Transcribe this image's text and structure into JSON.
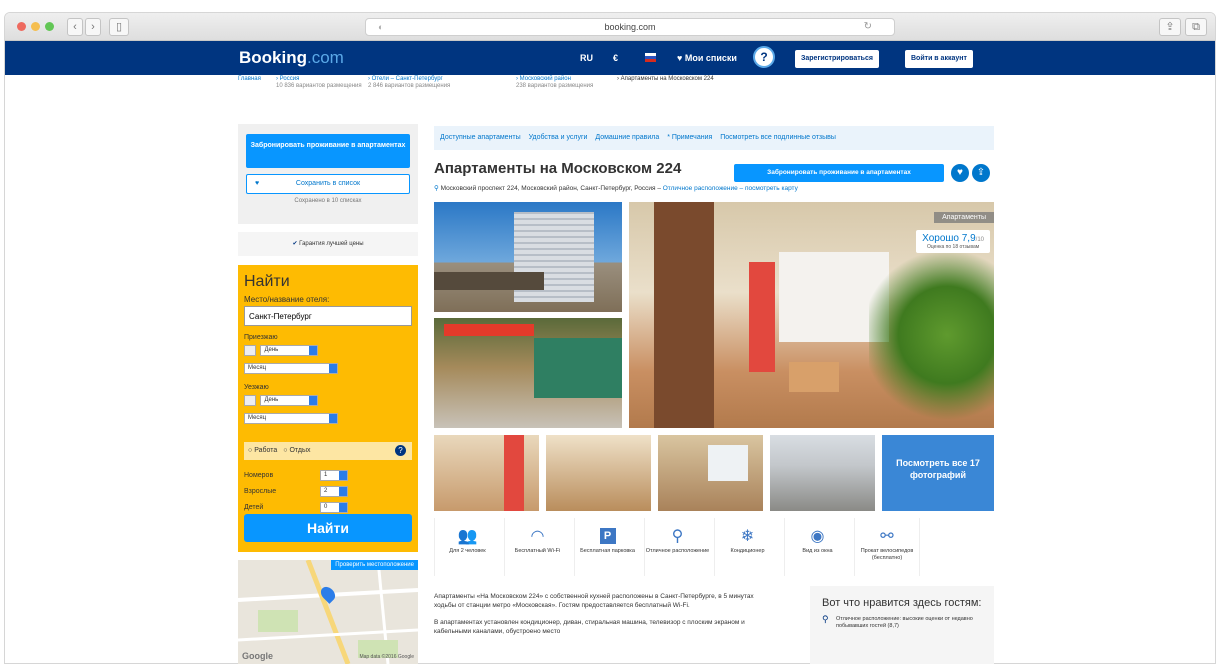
{
  "browser": {
    "url": "booking.com"
  },
  "header": {
    "logo_main": "Booking",
    "logo_suffix": ".com",
    "lang": "RU",
    "currency": "€",
    "wishlist": "Мои списки",
    "register": "Зарегистрироваться",
    "login": "Войти в аккаунт"
  },
  "breadcrumbs": [
    {
      "label": "Главная",
      "sub": ""
    },
    {
      "label": "Россия",
      "sub": "10 836 вариантов размещения"
    },
    {
      "label": "Отели – Санкт-Петербург",
      "sub": "2 846 вариантов размещения"
    },
    {
      "label": "Московский район",
      "sub": "238 вариантов размещения"
    },
    {
      "label": "Апартаменты на Московском 224",
      "sub": ""
    }
  ],
  "sidebar": {
    "book_button": "Забронировать проживание в апартаментах",
    "save_button": "Сохранить в список",
    "saved_count": "Сохранено в 10 списках",
    "guarantee": "Гарантия лучшей цены"
  },
  "search": {
    "title": "Найти",
    "destination_label": "Место/название отеля:",
    "destination_value": "Санкт-Петербург",
    "checkin_label": "Приезжаю",
    "checkout_label": "Уезжаю",
    "day": "День",
    "month": "Месяц",
    "work": "Работа",
    "leisure": "Отдых",
    "rooms_label": "Номеров",
    "rooms": "1",
    "adults_label": "Взрослые",
    "adults": "2",
    "children_label": "Детей",
    "children": "0",
    "submit": "Найти"
  },
  "map": {
    "check_location": "Проверить местоположение",
    "google": "Google",
    "attribution": "Map data ©2016 Google"
  },
  "tabs": [
    "Доступные апартаменты",
    "Удобства и услуги",
    "Домашние правила",
    "* Примечания",
    "Посмотреть все подлинные отзывы"
  ],
  "property": {
    "title": "Апартаменты на Московском 224",
    "book_button": "Забронировать проживание в апартаментах",
    "address": "Московский проспект 224, Московский район, Санкт-Петербург, Россия –",
    "location_link": "Отличное расположение – посмотреть карту",
    "type_badge": "Апартаменты",
    "rating_text": "Хорошо",
    "rating_value": "7,9",
    "rating_scale": "/10",
    "reviews": "Оценка по 18 отзывам",
    "all_photos": "Посмотреть все 17 фотографий"
  },
  "amenities": [
    {
      "icon": "people-icon",
      "label": "Для 2 человек"
    },
    {
      "icon": "wifi-icon",
      "label": "Бесплатный Wi-Fi"
    },
    {
      "icon": "parking-icon",
      "label": "Бесплатная парковка"
    },
    {
      "icon": "location-pin-icon",
      "label": "Отличное расположение"
    },
    {
      "icon": "snowflake-icon",
      "label": "Кондиционер"
    },
    {
      "icon": "eye-icon",
      "label": "Вид из окна"
    },
    {
      "icon": "bicycle-icon",
      "label": "Прокат велосипедов (бесплатно)"
    }
  ],
  "description": {
    "p1": "Апартаменты «На Московском 224» с собственной кухней расположены в Санкт-Петербурге, в 5 минутах ходьбы от станции метро «Московская». Гостям предоставляется бесплатный Wi-Fi.",
    "p2": "В апартаментах установлен кондиционер, диван, стиральная машина, телевизор с плоским экраном и кабельными каналами, обустроено место"
  },
  "likes": {
    "title": "Вот что нравится здесь гостям:",
    "item": "Отличное расположение: высокие оценки от недавно побывавших гостей (8,7)"
  }
}
